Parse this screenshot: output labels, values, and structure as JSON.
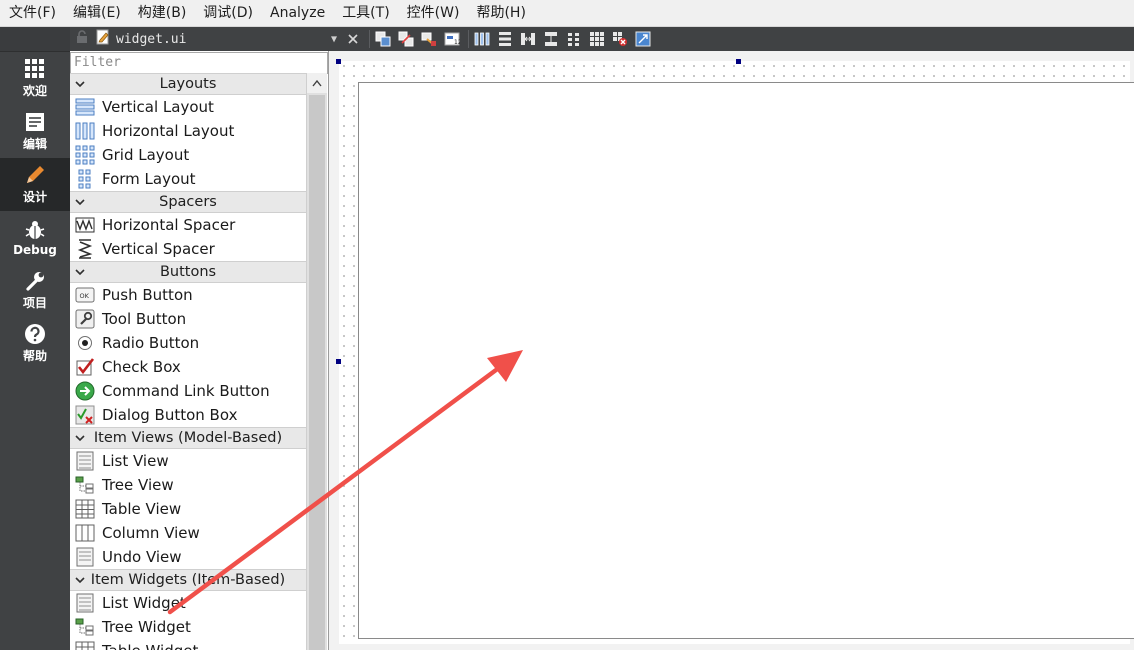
{
  "menu": [
    "文件(F)",
    "编辑(E)",
    "构建(B)",
    "调试(D)",
    "Analyze",
    "工具(T)",
    "控件(W)",
    "帮助(H)"
  ],
  "modes": [
    {
      "label": "欢迎",
      "icon": "grid-icon",
      "active": false
    },
    {
      "label": "编辑",
      "icon": "document-icon",
      "active": false
    },
    {
      "label": "设计",
      "icon": "pencil-icon",
      "active": true
    },
    {
      "label": "Debug",
      "icon": "bug-icon",
      "active": false
    },
    {
      "label": "项目",
      "icon": "wrench-icon",
      "active": false
    },
    {
      "label": "帮助",
      "icon": "help-icon",
      "active": false
    }
  ],
  "editor": {
    "file_name": "widget.ui"
  },
  "widget_box": {
    "filter_placeholder": "Filter",
    "categories": [
      {
        "title": "Layouts",
        "items": [
          {
            "label": "Vertical Layout",
            "icon": "vertical-layout-icon"
          },
          {
            "label": "Horizontal Layout",
            "icon": "horizontal-layout-icon"
          },
          {
            "label": "Grid Layout",
            "icon": "grid-layout-icon"
          },
          {
            "label": "Form Layout",
            "icon": "form-layout-icon"
          }
        ]
      },
      {
        "title": "Spacers",
        "items": [
          {
            "label": "Horizontal Spacer",
            "icon": "horizontal-spacer-icon"
          },
          {
            "label": "Vertical Spacer",
            "icon": "vertical-spacer-icon"
          }
        ]
      },
      {
        "title": "Buttons",
        "items": [
          {
            "label": "Push Button",
            "icon": "push-button-icon"
          },
          {
            "label": "Tool Button",
            "icon": "tool-button-icon"
          },
          {
            "label": "Radio Button",
            "icon": "radio-button-icon"
          },
          {
            "label": "Check Box",
            "icon": "check-box-icon"
          },
          {
            "label": "Command Link Button",
            "icon": "command-link-icon"
          },
          {
            "label": "Dialog Button Box",
            "icon": "dialog-button-box-icon"
          }
        ]
      },
      {
        "title": "Item Views (Model-Based)",
        "items": [
          {
            "label": "List View",
            "icon": "list-view-icon"
          },
          {
            "label": "Tree View",
            "icon": "tree-view-icon"
          },
          {
            "label": "Table View",
            "icon": "table-view-icon"
          },
          {
            "label": "Column View",
            "icon": "column-view-icon"
          },
          {
            "label": "Undo View",
            "icon": "undo-view-icon"
          }
        ]
      },
      {
        "title": "Item Widgets (Item-Based)",
        "items": [
          {
            "label": "List Widget",
            "icon": "list-widget-icon"
          },
          {
            "label": "Tree Widget",
            "icon": "tree-widget-icon"
          },
          {
            "label": "Table Widget",
            "icon": "table-widget-icon"
          }
        ]
      }
    ]
  },
  "colors": {
    "sidebar_bg": "#404244",
    "sidebar_active": "#262829",
    "annotation_arrow": "#f0504a",
    "selection_handle": "#000080"
  }
}
